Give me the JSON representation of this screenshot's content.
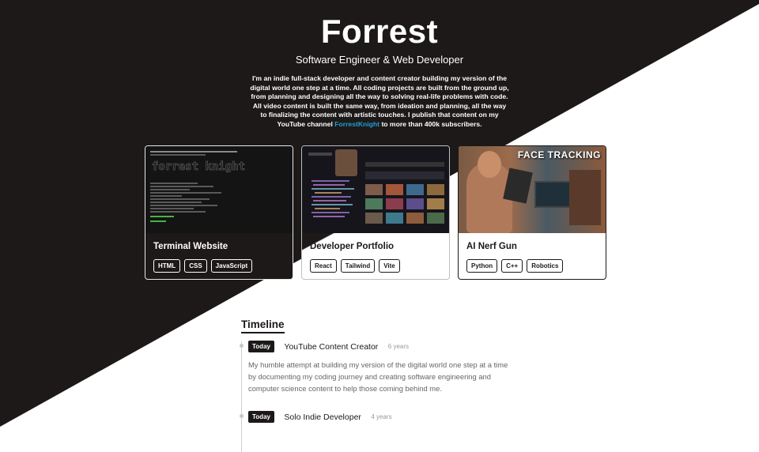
{
  "hero": {
    "name": "Forrest",
    "subtitle": "Software Engineer & Web Developer",
    "bio_text": "I'm an indie full-stack developer and content creator building my version of the digital world one step at a time. All coding projects are built from the ground up, from planning and designing all the way to solving real-life problems with code. All video content is built the same way, from ideation and planning, all the way to finalizing the content with artistic touches. I publish that content on my YouTube channel",
    "bio_link": "ForrestKnight",
    "bio_tail": "to more than 400k subscribers."
  },
  "projects": [
    {
      "title": "Terminal Website",
      "tags": [
        "HTML",
        "CSS",
        "JavaScript"
      ]
    },
    {
      "title": "Developer Portfolio",
      "tags": [
        "React",
        "Tailwind",
        "Vite"
      ]
    },
    {
      "title": "AI Nerf Gun",
      "tags": [
        "Python",
        "C++",
        "Robotics"
      ],
      "thumb_overlay": "FACE TRACKING"
    }
  ],
  "timeline": {
    "heading": "Timeline",
    "items": [
      {
        "badge": "Today",
        "title": "YouTube Content Creator",
        "years": "6 years",
        "description": "My humble attempt at building my version of the digital world one step at a time by documenting my coding journey and creating software engineering and computer science content to help those coming behind me."
      },
      {
        "badge": "Today",
        "title": "Solo Indie Developer",
        "years": "4 years"
      }
    ]
  },
  "colors": {
    "dark": "#1c1918",
    "light": "#ffffff",
    "link": "#1f9fd8"
  }
}
